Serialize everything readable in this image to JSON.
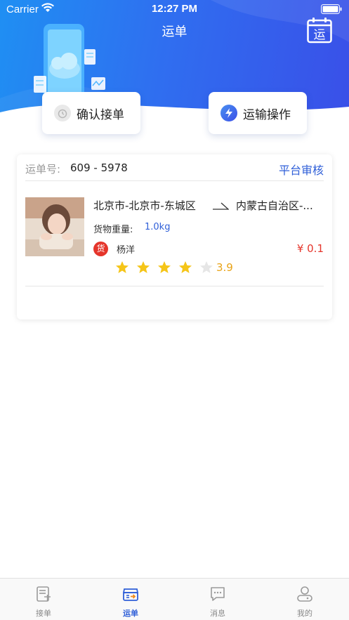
{
  "status_bar": {
    "carrier": "Carrier",
    "time": "12:27 PM"
  },
  "header": {
    "title": "运单",
    "calendar_icon_char": "运"
  },
  "actions": {
    "confirm_label": "确认接单",
    "transport_label": "运输操作"
  },
  "order": {
    "number_label": "运单号:",
    "number": "609 - 5978",
    "review_label": "平台审核",
    "from": "北京市-北京市-东城区",
    "to": "内蒙古自治区-...",
    "weight_label": "货物重量:",
    "weight_value": "1.0kg",
    "goods_badge": "货",
    "shipper_name": "杨洋",
    "price": "¥ 0.1",
    "rating_value": "3.9",
    "stars_filled": 4,
    "stars_total": 5
  },
  "tabs": [
    {
      "label": "接单",
      "icon": "document-icon",
      "active": false
    },
    {
      "label": "运单",
      "icon": "truck-box-icon",
      "active": true
    },
    {
      "label": "消息",
      "icon": "message-icon",
      "active": false
    },
    {
      "label": "我的",
      "icon": "person-icon",
      "active": false
    }
  ],
  "colors": {
    "accent": "#2f5fd8",
    "price": "#e5352b",
    "star": "#f5c518"
  }
}
